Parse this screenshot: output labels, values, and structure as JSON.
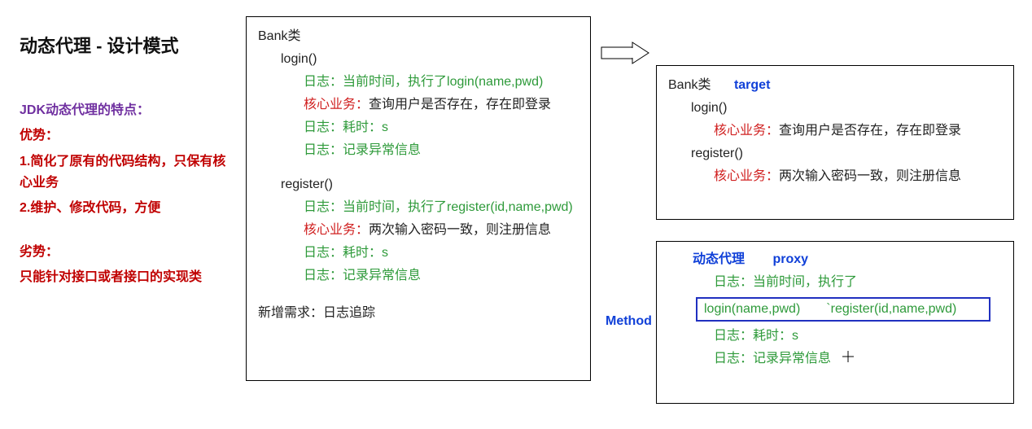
{
  "title": "动态代理 - 设计模式",
  "left": {
    "jdk": "JDK动态代理的特点：",
    "adv_label": "优势：",
    "adv1": "1.简化了原有的代码结构，只保有核心业务",
    "adv2": "2.维护、修改代码，方便",
    "dis_label": "劣势：",
    "dis1": "只能针对接口或者接口的实现类"
  },
  "mid": {
    "class": "Bank类",
    "login": "login()",
    "login_log1_lbl": "日志：",
    "login_log1_txt": "当前时间，执行了login(name,pwd)",
    "login_core_lbl": "核心业务：",
    "login_core_txt": "查询用户是否存在，存在即登录",
    "login_log2_lbl": "日志：",
    "login_log2_txt": "耗时：s",
    "login_log3_lbl": "日志：",
    "login_log3_txt": "记录异常信息",
    "register": "register()",
    "reg_log1_lbl": "日志：",
    "reg_log1_txt": "当前时间，执行了register(id,name,pwd)",
    "reg_core_lbl": "核心业务：",
    "reg_core_txt": "两次输入密码一致，则注册信息",
    "reg_log2_lbl": "日志：",
    "reg_log2_txt": "耗时：s",
    "reg_log3_lbl": "日志：",
    "reg_log3_txt": "记录异常信息",
    "new_req": "新增需求：日志追踪"
  },
  "target": {
    "class": "Bank类",
    "label": "target",
    "login": "login()",
    "login_core_lbl": "核心业务：",
    "login_core_txt": "查询用户是否存在，存在即登录",
    "register": "register()",
    "reg_core_lbl": "核心业务：",
    "reg_core_txt": "两次输入密码一致，则注册信息"
  },
  "proxy": {
    "title": "动态代理",
    "label": "proxy",
    "method": "Method",
    "log1_lbl": "日志：",
    "log1_txt": "当前时间，执行了",
    "m1": "login(name,pwd)",
    "m2": "`register(id,name,pwd)",
    "log2_lbl": "日志：",
    "log2_txt": "耗时：s",
    "log3_lbl": "日志：",
    "log3_txt": "记录异常信息"
  },
  "colors": {
    "purple": "#7030a0",
    "red": "#c00000",
    "green": "#2e9a3a",
    "blue": "#1040d8"
  }
}
